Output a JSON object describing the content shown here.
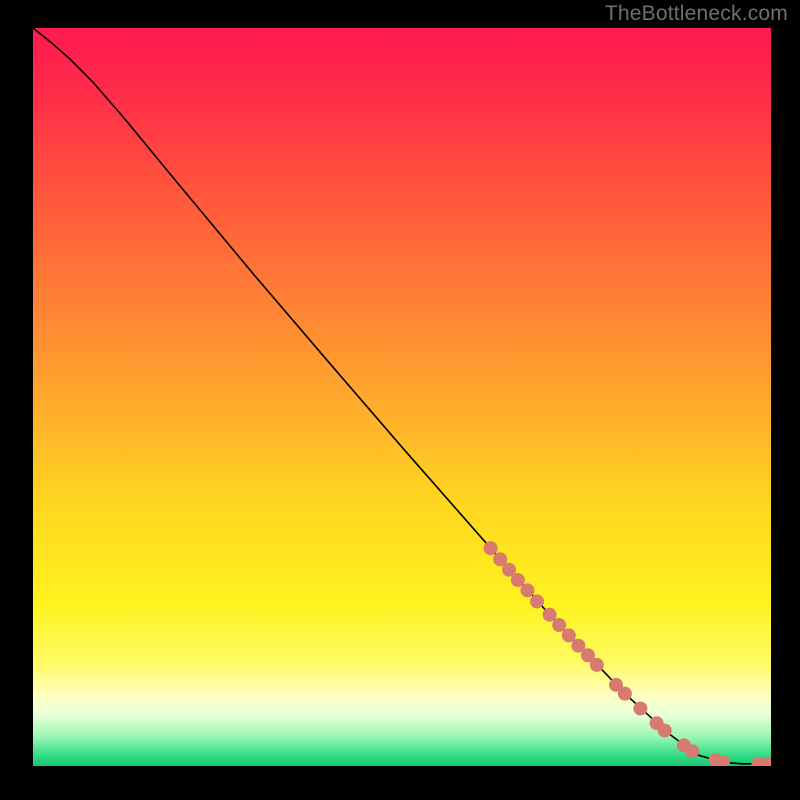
{
  "watermark": "TheBottleneck.com",
  "marker_color": "#d77a70",
  "marker_radius_px": 7,
  "line_color": "#000000",
  "gradient_stops": [
    {
      "offset": 0.0,
      "color": "#ff1a4f"
    },
    {
      "offset": 0.08,
      "color": "#ff2a4a"
    },
    {
      "offset": 0.2,
      "color": "#ff4f3e"
    },
    {
      "offset": 0.35,
      "color": "#ff7b36"
    },
    {
      "offset": 0.5,
      "color": "#ffa82d"
    },
    {
      "offset": 0.65,
      "color": "#ffd81f"
    },
    {
      "offset": 0.78,
      "color": "#fff220"
    },
    {
      "offset": 0.86,
      "color": "#fffb63"
    },
    {
      "offset": 0.905,
      "color": "#ffffc2"
    },
    {
      "offset": 0.93,
      "color": "#e9ffd8"
    },
    {
      "offset": 0.96,
      "color": "#9cf7b5"
    },
    {
      "offset": 0.985,
      "color": "#34dd87"
    },
    {
      "offset": 1.0,
      "color": "#14c86f"
    }
  ],
  "chart_data": {
    "type": "line",
    "title": "",
    "xlabel": "",
    "ylabel": "",
    "xlim": [
      0,
      100
    ],
    "ylim": [
      0,
      100
    ],
    "series": [
      {
        "name": "curve",
        "style": "line",
        "points": [
          {
            "x": 0.0,
            "y": 100.0
          },
          {
            "x": 2.5,
            "y": 98.0
          },
          {
            "x": 5.0,
            "y": 95.8
          },
          {
            "x": 8.0,
            "y": 92.8
          },
          {
            "x": 12.0,
            "y": 88.2
          },
          {
            "x": 20.0,
            "y": 78.5
          },
          {
            "x": 30.0,
            "y": 66.5
          },
          {
            "x": 40.0,
            "y": 54.8
          },
          {
            "x": 50.0,
            "y": 43.2
          },
          {
            "x": 60.0,
            "y": 31.8
          },
          {
            "x": 70.0,
            "y": 20.5
          },
          {
            "x": 80.0,
            "y": 10.0
          },
          {
            "x": 86.0,
            "y": 4.5
          },
          {
            "x": 90.0,
            "y": 1.5
          },
          {
            "x": 93.5,
            "y": 0.5
          },
          {
            "x": 96.0,
            "y": 0.3
          },
          {
            "x": 100.0,
            "y": 0.3
          }
        ]
      },
      {
        "name": "markers",
        "style": "marker",
        "points": [
          {
            "x": 62.0,
            "y": 29.5
          },
          {
            "x": 63.3,
            "y": 28.0
          },
          {
            "x": 64.5,
            "y": 26.6
          },
          {
            "x": 65.7,
            "y": 25.2
          },
          {
            "x": 67.0,
            "y": 23.8
          },
          {
            "x": 68.3,
            "y": 22.3
          },
          {
            "x": 70.0,
            "y": 20.5
          },
          {
            "x": 71.3,
            "y": 19.1
          },
          {
            "x": 72.6,
            "y": 17.7
          },
          {
            "x": 73.9,
            "y": 16.3
          },
          {
            "x": 75.2,
            "y": 15.0
          },
          {
            "x": 76.4,
            "y": 13.7
          },
          {
            "x": 79.0,
            "y": 11.0
          },
          {
            "x": 80.2,
            "y": 9.8
          },
          {
            "x": 82.3,
            "y": 7.8
          },
          {
            "x": 84.5,
            "y": 5.8
          },
          {
            "x": 85.6,
            "y": 4.8
          },
          {
            "x": 88.2,
            "y": 2.8
          },
          {
            "x": 89.3,
            "y": 2.0
          },
          {
            "x": 92.5,
            "y": 0.8
          },
          {
            "x": 93.5,
            "y": 0.5
          },
          {
            "x": 98.3,
            "y": 0.3
          },
          {
            "x": 99.5,
            "y": 0.3
          }
        ]
      }
    ]
  }
}
